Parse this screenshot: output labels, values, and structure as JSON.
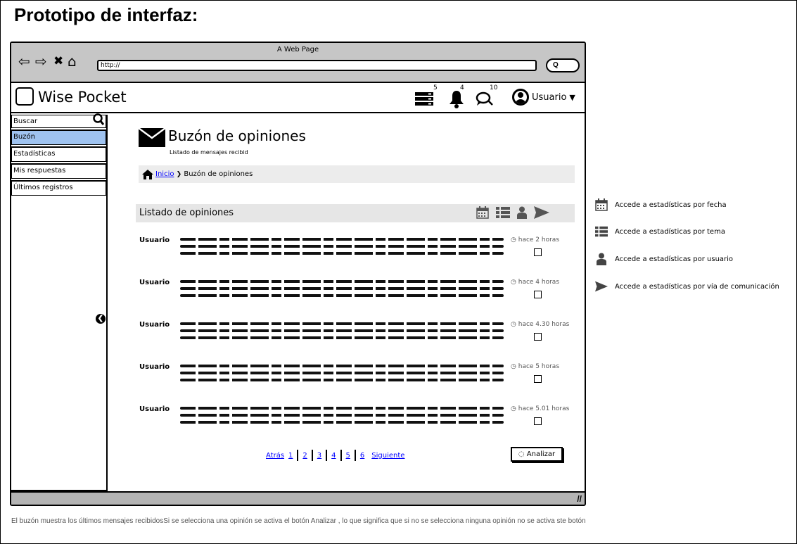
{
  "page": {
    "title": "Prototipo de interfaz:",
    "caption": "El buzón muestra los últimos mensajes recibidosSi se selecciona una opinión se activa el botón Analizar , lo que significa que si no se selecciona ninguna opinión no se activa ste botón"
  },
  "browser": {
    "title": "A Web Page",
    "url": "http://",
    "search_label": "Q"
  },
  "header": {
    "app_name": "Wise Pocket",
    "badges": {
      "list": "5",
      "notifications": "4",
      "messages": "10"
    },
    "user_label": "Usuario"
  },
  "sidebar": {
    "search_placeholder": "Buscar",
    "items": [
      {
        "label": "Buzón",
        "active": true
      },
      {
        "label": "Estadísticas",
        "active": false
      },
      {
        "label": "Mis respuestas",
        "active": false
      },
      {
        "label": "Últimos registros",
        "active": false
      }
    ]
  },
  "main": {
    "title": "Buzón de opiniones",
    "subtitle": "Listado de mensajes recibid",
    "breadcrumb": {
      "home": "Inicio",
      "current": "Buzón de opiniones"
    },
    "list_title": "Listado de opiniones",
    "messages": [
      {
        "user": "Usuario",
        "time": "hace 2 horas"
      },
      {
        "user": "Usuario",
        "time": "hace 4 horas"
      },
      {
        "user": "Usuario",
        "time": "hace 4.30 horas"
      },
      {
        "user": "Usuario",
        "time": "hace 5 horas"
      },
      {
        "user": "Usuario",
        "time": "hace 5.01 horas"
      }
    ],
    "pagination": {
      "prev": "Atrás",
      "pages": [
        "1",
        "2",
        "3",
        "4",
        "5",
        "6"
      ],
      "next": "Siguiente"
    },
    "analyze_button": "Analizar"
  },
  "legend": [
    {
      "icon": "calendar-icon",
      "text": "Accede a estadísticas por fecha"
    },
    {
      "icon": "list-icon",
      "text": "Accede a estadísticas por tema"
    },
    {
      "icon": "user-icon",
      "text": "Accede a estadísticas por usuario"
    },
    {
      "icon": "send-icon",
      "text": "Accede a estadísticas por vía de comunicación"
    }
  ]
}
